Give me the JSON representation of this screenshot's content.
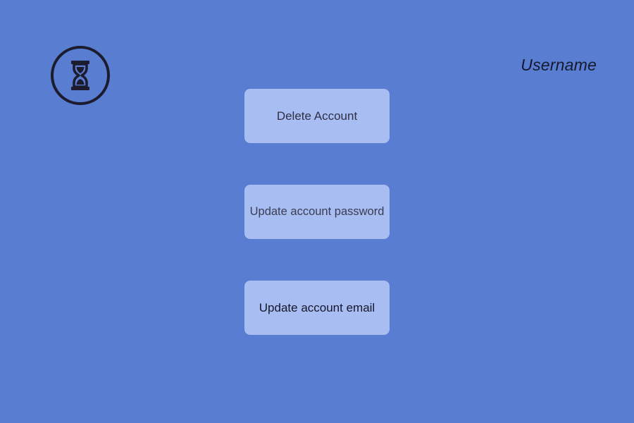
{
  "header": {
    "logo_icon": "hourglass-icon",
    "username": "Username"
  },
  "actions": {
    "delete_label": "Delete Account",
    "update_password_label": "Update account password",
    "update_email_label": "Update account email"
  },
  "colors": {
    "background": "#587dd1",
    "button_background": "#a8bdf2",
    "icon_color": "#1c1c2e"
  }
}
